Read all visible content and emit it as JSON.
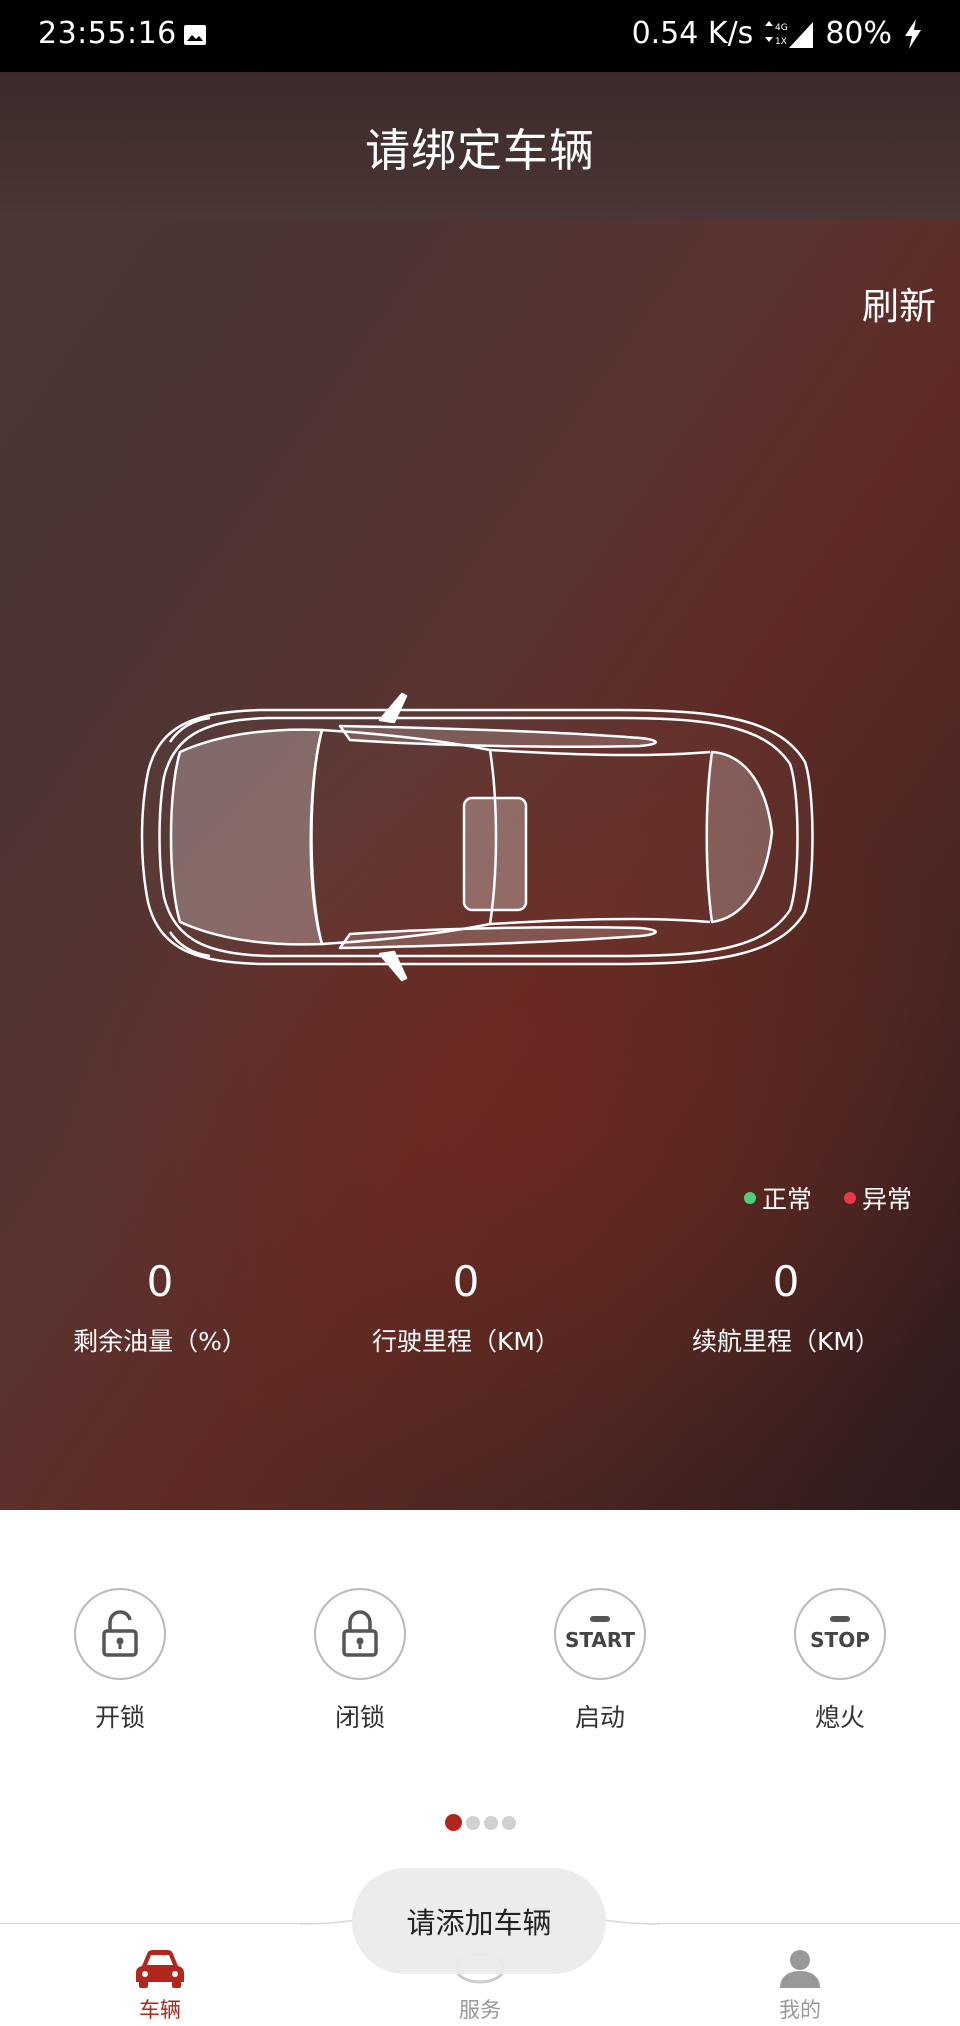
{
  "status_bar": {
    "time": "23:55:16",
    "network_speed": "0.54 K/s",
    "battery": "80%",
    "icons": [
      "image-icon",
      "signal-4g-icon",
      "charging-icon"
    ]
  },
  "header": {
    "title": "请绑定车辆"
  },
  "refresh_label": "刷新",
  "legend": {
    "normal": "正常",
    "abnormal": "异常",
    "normal_color": "#4cd07a",
    "abnormal_color": "#e8384a"
  },
  "stats": [
    {
      "value": "0",
      "label": "剩余油量（%）"
    },
    {
      "value": "0",
      "label": "行驶里程（KM）"
    },
    {
      "value": "0",
      "label": "续航里程（KM）"
    }
  ],
  "controls": [
    {
      "label": "开锁",
      "icon": "unlock-icon"
    },
    {
      "label": "闭锁",
      "icon": "lock-icon"
    },
    {
      "label": "启动",
      "icon": "start-icon",
      "word": "START"
    },
    {
      "label": "熄火",
      "icon": "stop-icon",
      "word": "STOP"
    }
  ],
  "pager": {
    "count": 4,
    "active": 0
  },
  "toast": "请添加车辆",
  "bottom_nav": [
    {
      "label": "车辆",
      "icon": "car-icon",
      "active": true
    },
    {
      "label": "服务",
      "icon": "jac-logo-icon",
      "active": false
    },
    {
      "label": "我的",
      "icon": "person-icon",
      "active": false
    }
  ],
  "colors": {
    "accent": "#b2271d",
    "status_bar": "#000000"
  }
}
